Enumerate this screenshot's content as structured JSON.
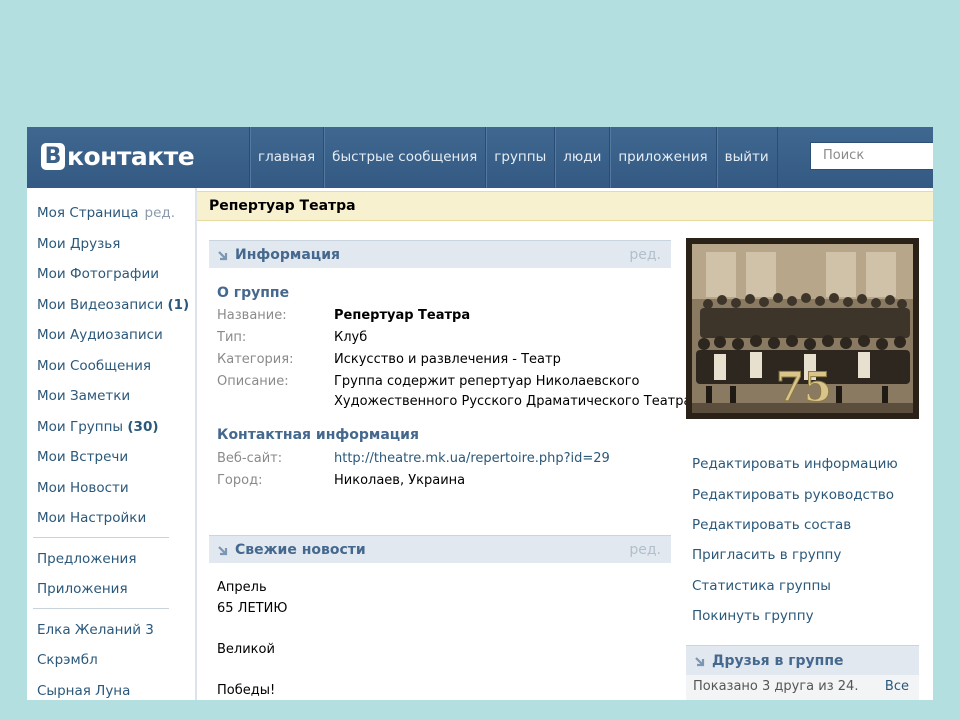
{
  "header": {
    "logo_letter": "B",
    "logo_text": "контакте",
    "nav": [
      "главная",
      "быстрые сообщения",
      "группы",
      "люди",
      "приложения",
      "выйти"
    ],
    "search_placeholder": "Поиск"
  },
  "sidebar": {
    "my_page": "Моя Страница",
    "my_page_edit": "ред.",
    "friends": "Мои Друзья",
    "photos": "Мои Фотографии",
    "videos": "Мои Видеозаписи",
    "videos_count": "(1)",
    "audio": "Мои Аудиозаписи",
    "messages": "Мои Сообщения",
    "notes": "Мои Заметки",
    "groups": "Мои Группы",
    "groups_count": "(30)",
    "events": "Мои Встречи",
    "news": "Мои Новости",
    "settings": "Мои Настройки",
    "offers": "Предложения",
    "apps": "Приложения",
    "app1": "Елка Желаний 3",
    "app2": "Скрэмбл",
    "app3": "Сырная Луна"
  },
  "page_title": "Репертуар Театра",
  "info": {
    "section_title": "Информация",
    "edit": "ред.",
    "about_title": "О группе",
    "name_label": "Название:",
    "name_value": "Репертуар Театра",
    "type_label": "Тип:",
    "type_value": "Клуб",
    "category_label": "Категория:",
    "category_value": "Искусство и развлечения - Театр",
    "description_label": "Описание:",
    "description_line1": "Группа содержит репертуар Николаевского",
    "description_line2": "Художественного Русского Драматического Театра",
    "contact_title": "Контактная информация",
    "website_label": "Веб-сайт:",
    "website_value": "http://theatre.mk.ua/repertoire.php?id=29",
    "city_label": "Город:",
    "city_value": "Николаев, Украина"
  },
  "news": {
    "section_title": "Свежие новости",
    "edit": "ред.",
    "lines": [
      "Апрель",
      "65 ЛЕТИЮ",
      "Великой",
      "Победы!"
    ]
  },
  "photo": {
    "badge": "75"
  },
  "actions": [
    "Редактировать информацию",
    "Редактировать руководство",
    "Редактировать состав",
    "Пригласить в группу",
    "Статистика группы",
    "Покинуть группу"
  ],
  "friends_box": {
    "title": "Друзья в группе",
    "shown": "Показано 3 друга из 24.",
    "all": "Все"
  },
  "colors": {
    "background": "#b4dfe0",
    "header": "#3b6189",
    "link": "#2b587a",
    "section_title": "#45688e"
  }
}
